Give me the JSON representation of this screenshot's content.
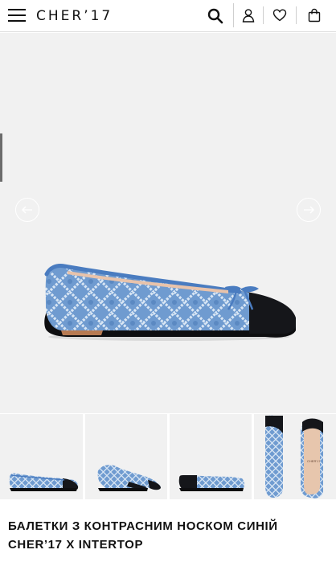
{
  "header": {
    "logo": "CHER’17",
    "icons": [
      "menu-icon",
      "search-icon",
      "user-icon",
      "heart-icon",
      "bag-icon"
    ]
  },
  "gallery": {
    "prev_icon": "arrow-left-icon",
    "next_icon": "arrow-right-icon",
    "thumbnail_count": 4,
    "colors": {
      "denim": "#6f9bd0",
      "denim_light": "#c6d9ee",
      "toe_cap": "#121316",
      "background": "#f1f1f1"
    }
  },
  "product": {
    "title": "БАЛЕТКИ З КОНТРАСНИМ НОСКОМ СИНІЙ CHER’17 X INTERTOP"
  }
}
